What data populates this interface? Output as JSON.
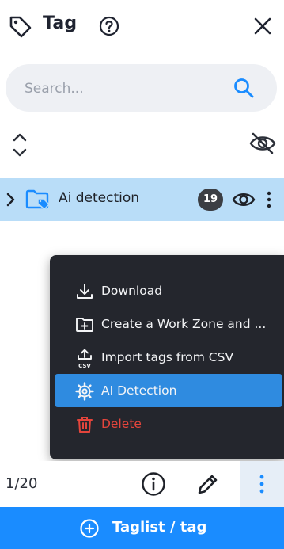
{
  "header": {
    "title": "Tag",
    "icons": [
      "tag-icon",
      "help-icon",
      "close-icon"
    ]
  },
  "search": {
    "placeholder": "Search...",
    "value": ""
  },
  "toolbar": {
    "icons": [
      "expand-collapse-icon",
      "hide-all-icon"
    ]
  },
  "folder": {
    "label": "Ai detection",
    "count": "19",
    "icons": [
      "chevron-right-icon",
      "folder-tag-icon",
      "eye-icon",
      "kebab-icon"
    ]
  },
  "menu": {
    "items": [
      {
        "label": "Download",
        "icon": "download-icon"
      },
      {
        "label": "Create a Work Zone and ...",
        "icon": "folder-add-icon"
      },
      {
        "label": "Import tags from CSV",
        "icon": "csv-import-icon"
      },
      {
        "label": "AI Detection",
        "icon": "gear-icon",
        "active": true
      },
      {
        "label": "Delete",
        "icon": "trash-icon",
        "danger": true
      }
    ],
    "icon_csv_text": "CSV"
  },
  "footer": {
    "page_count": "1/20",
    "cta_label": "Taglist / tag"
  },
  "colors": {
    "accent": "#1a8cff",
    "selected_row": "#b9ddf8",
    "menu_bg": "#24262d",
    "menu_active": "#2f8be0",
    "danger": "#e4453c"
  }
}
